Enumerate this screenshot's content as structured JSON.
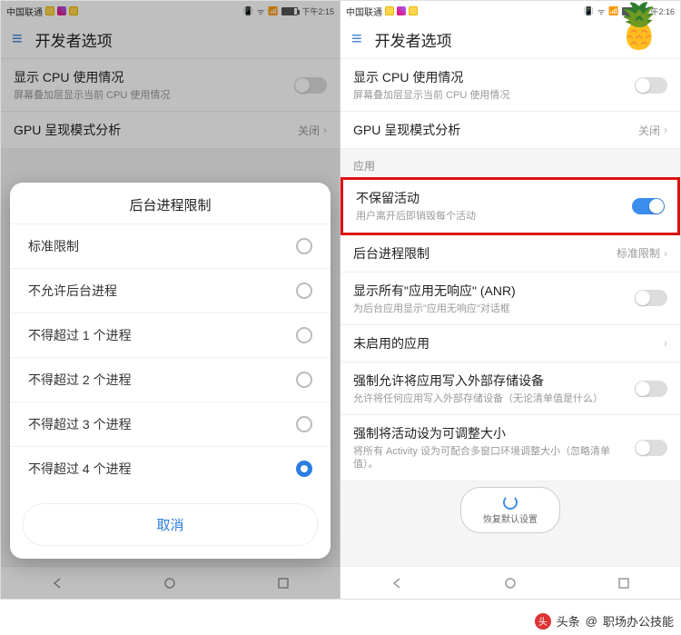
{
  "decor": {
    "pineapple": "🍍"
  },
  "credit": {
    "prefix": "头条",
    "separator": "@",
    "name": "职场办公技能"
  },
  "left": {
    "status": {
      "carrier": "中国联通",
      "time": "下午2:15",
      "signal": "📶",
      "wifi": "ᯤ",
      "vibrate": "📳"
    },
    "appbar": {
      "title": "开发者选项"
    },
    "rows": {
      "cpu": {
        "title": "显示 CPU 使用情况",
        "sub": "屏幕叠加层显示当前 CPU 使用情况"
      },
      "gpu": {
        "title": "GPU 呈现模式分析",
        "value": "关闭"
      }
    },
    "sheet": {
      "title": "后台进程限制",
      "options": [
        "标准限制",
        "不允许后台进程",
        "不得超过 1 个进程",
        "不得超过 2 个进程",
        "不得超过 3 个进程",
        "不得超过 4 个进程"
      ],
      "selectedIndex": 5,
      "cancel": "取消"
    }
  },
  "right": {
    "status": {
      "carrier": "中国联通",
      "time": "下午2:16",
      "signal": "📶",
      "wifi": "ᯤ",
      "vibrate": "📳"
    },
    "appbar": {
      "title": "开发者选项"
    },
    "sections": {
      "apps": "应用"
    },
    "rows": {
      "cpu": {
        "title": "显示 CPU 使用情况",
        "sub": "屏幕叠加层显示当前 CPU 使用情况"
      },
      "gpu": {
        "title": "GPU 呈现模式分析",
        "value": "关闭"
      },
      "noKeep": {
        "title": "不保留活动",
        "sub": "用户离开后即销毁每个活动",
        "on": true
      },
      "bgLimit": {
        "title": "后台进程限制",
        "value": "标准限制"
      },
      "anr": {
        "title": "显示所有\"应用无响应\" (ANR)",
        "sub": "为后台应用显示\"应用无响应\"对话框"
      },
      "disabled": {
        "title": "未启用的应用"
      },
      "extWrite": {
        "title": "强制允许将应用写入外部存储设备",
        "sub": "允许将任何应用写入外部存储设备（无论清单值是什么）"
      },
      "resize": {
        "title": "强制将活动设为可调整大小",
        "sub": "将所有 Activity 设为可配合多窗口环境调整大小（忽略清单值）。"
      }
    },
    "reset": {
      "label": "恢复默认设置"
    }
  }
}
